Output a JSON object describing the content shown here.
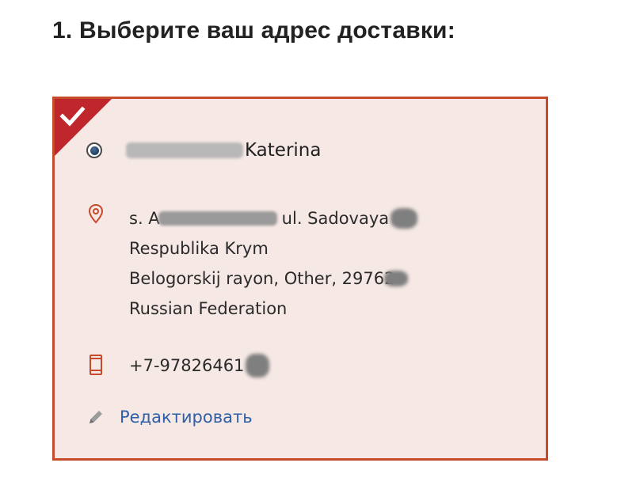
{
  "heading": "1. Выберите ваш адрес доставки:",
  "card": {
    "selected": true,
    "recipient": {
      "visible_name": "Katerina"
    },
    "address": {
      "line1_prefix": "s. A",
      "line1_street": "ul. Sadovaya",
      "line2": "Respublika Krym",
      "line3": "Belogorskij rayon, Other, 29762",
      "line4": "Russian Federation"
    },
    "phone": "+7-97826461",
    "edit_label": "Редактировать"
  },
  "colors": {
    "accent_border": "#c74a2a",
    "card_background": "#f6e8e4",
    "corner_flag": "#c0272d",
    "link": "#2e5fa8",
    "icon": "#c74a2a"
  },
  "icons": {
    "corner": "checkmark-icon",
    "address": "map-pin-icon",
    "phone": "mobile-phone-icon",
    "edit": "pencil-icon"
  }
}
